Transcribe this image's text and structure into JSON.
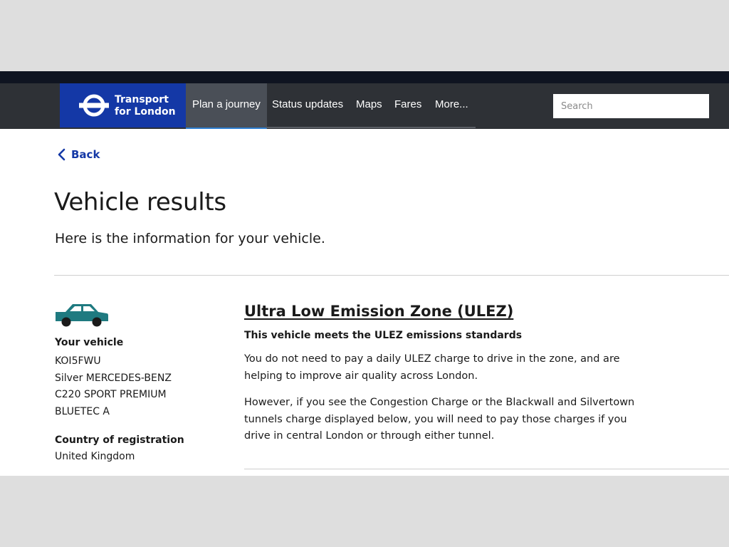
{
  "header": {
    "logo_line1": "Transport",
    "logo_line2": "for London",
    "nav": [
      "Plan a journey",
      "Status updates",
      "Maps",
      "Fares",
      "More..."
    ],
    "search_placeholder": "Search"
  },
  "back_label": "Back",
  "page_title": "Vehicle results",
  "subtitle": "Here is the information for your vehicle.",
  "vehicle": {
    "heading": "Your vehicle",
    "registration": "KOI5FWU",
    "description_lines": [
      "Silver MERCEDES-BENZ",
      "C220 SPORT PREMIUM",
      "BLUETEC A"
    ],
    "country_heading": "Country of registration",
    "country": "United Kingdom"
  },
  "ulez": {
    "title": "Ultra Low Emission Zone (ULEZ)",
    "status": "This vehicle meets the ULEZ emissions standards",
    "para1": "You do not need to pay a daily ULEZ charge to drive in the zone, and are helping to improve air quality across London.",
    "para2": "However, if you see the Congestion Charge or the Blackwall and Silvertown tunnels charge displayed below, you will need to pay those charges if you drive in central London or through either tunnel."
  },
  "colors": {
    "tfl_blue": "#1438a6",
    "nav_bg": "#2e3136",
    "car_teal": "#1f7a80"
  }
}
